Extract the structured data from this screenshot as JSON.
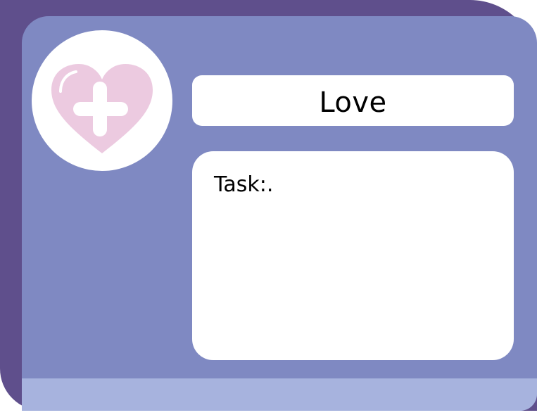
{
  "card": {
    "title": "Love",
    "task_label": "Task:.",
    "icon": "heart-plus-icon"
  },
  "colors": {
    "card_back": "#5f4f8c",
    "card_front": "#7f89c2",
    "card_footer": "#a7b3de",
    "panel": "#ffffff",
    "heart": "#eccae0",
    "text": "#000000"
  }
}
